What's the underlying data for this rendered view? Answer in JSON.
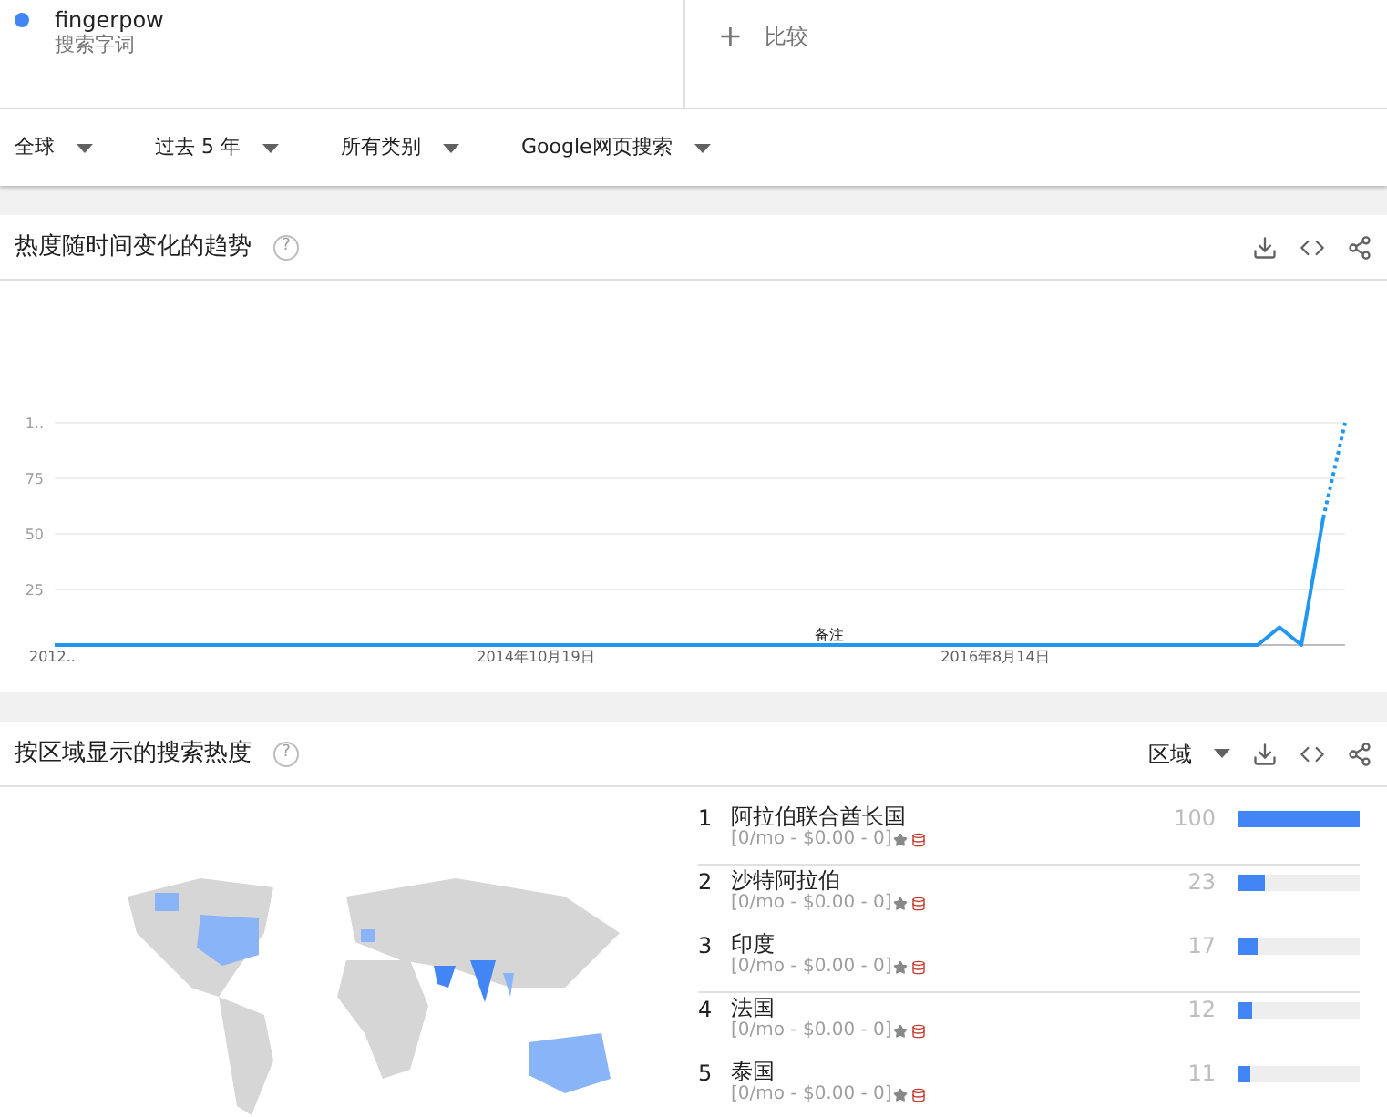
{
  "search_term": {
    "color": "#4285f4",
    "term": "fingerpow",
    "subtitle": "搜索字词"
  },
  "compare": {
    "icon": "+",
    "label": "比较"
  },
  "filters": [
    {
      "label": "全球"
    },
    {
      "label": "过去 5 年"
    },
    {
      "label": "所有类别"
    },
    {
      "label": "Google网页搜索"
    }
  ],
  "interest_over_time": {
    "title": "热度随时间变化的趋势",
    "help": "?",
    "top_tick_label": "1..",
    "chart_data": {
      "type": "line",
      "categories": [
        "2012..",
        null,
        null,
        null,
        null,
        null,
        null,
        null,
        null,
        null,
        null,
        null,
        null,
        null,
        null,
        null,
        null,
        null,
        null,
        null,
        null,
        null,
        "2014年10月19日",
        null,
        null,
        null,
        null,
        null,
        null,
        null,
        null,
        null,
        null,
        null,
        null,
        null,
        null,
        null,
        null,
        null,
        null,
        null,
        null,
        "2016年8月14日",
        null,
        null,
        null,
        null,
        null,
        null,
        null,
        null,
        null,
        null,
        null,
        null,
        null,
        null,
        null,
        null
      ],
      "grid": true,
      "ylim": [
        0,
        100
      ],
      "series": [
        {
          "color": "#2196f3",
          "line_style": "solid",
          "values": [
            0,
            0,
            0,
            0,
            0,
            0,
            0,
            0,
            0,
            0,
            0,
            0,
            0,
            0,
            0,
            0,
            0,
            0,
            0,
            0,
            0,
            0,
            0,
            0,
            0,
            0,
            0,
            0,
            0,
            0,
            0,
            0,
            0,
            0,
            0,
            0,
            0,
            0,
            0,
            0,
            0,
            0,
            0,
            0,
            0,
            0,
            0,
            0,
            0,
            0,
            0,
            0,
            0,
            0,
            0,
            0,
            8,
            0,
            57,
            null
          ]
        },
        {
          "color": "#2196f3",
          "line_style": "dotted",
          "values": [
            null,
            null,
            null,
            null,
            null,
            null,
            null,
            null,
            null,
            null,
            null,
            null,
            null,
            null,
            null,
            null,
            null,
            null,
            null,
            null,
            null,
            null,
            null,
            null,
            null,
            null,
            null,
            null,
            null,
            null,
            null,
            null,
            null,
            null,
            null,
            null,
            null,
            null,
            null,
            null,
            null,
            null,
            null,
            null,
            null,
            null,
            null,
            null,
            null,
            null,
            null,
            null,
            null,
            null,
            null,
            null,
            null,
            null,
            57,
            100
          ]
        }
      ],
      "yticks": [
        25,
        50,
        75
      ],
      "annotations": [
        {
          "text": "备注"
        }
      ]
    }
  },
  "interest_by_region": {
    "title": "按区域显示的搜索热度",
    "help": "?",
    "resolution": "区域",
    "regions": [
      {
        "rank": "1",
        "name": "阿拉伯联合酋长国",
        "stats": "[0/mo - $0.00 - 0]",
        "score": "100",
        "level": 1
      },
      {
        "rank": "2",
        "name": "沙特阿拉伯",
        "stats": "[0/mo - $0.00 - 0]",
        "score": "23",
        "level": 0.23
      },
      {
        "rank": "3",
        "name": "印度",
        "stats": "[0/mo - $0.00 - 0]",
        "score": "17",
        "level": 0.17
      },
      {
        "rank": "4",
        "name": "法国",
        "stats": "[0/mo - $0.00 - 0]",
        "score": "12",
        "level": 0.12
      },
      {
        "rank": "5",
        "name": "泰国",
        "stats": "[0/mo - $0.00 - 0]",
        "score": "11",
        "level": 0.11
      }
    ]
  }
}
